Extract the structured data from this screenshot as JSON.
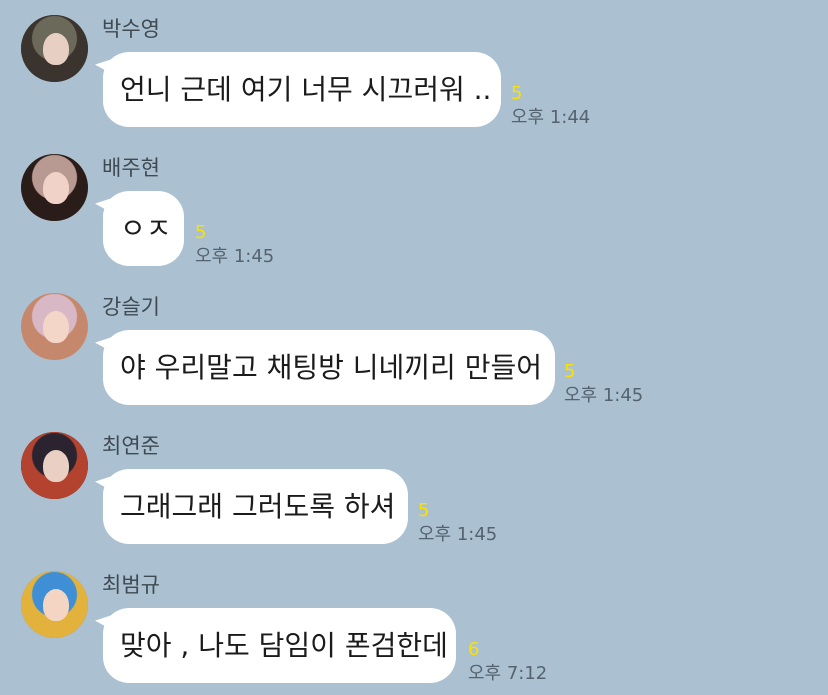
{
  "chat": {
    "messages": [
      {
        "sender": "박수영",
        "text": "언니 근데 여기 너무 시끄러워 ..",
        "unread": "5",
        "time": "오후 1:44",
        "avatar_colors": {
          "hair": "#3b332e",
          "face": "#e8cfc3",
          "bg": "#6b6a5a"
        }
      },
      {
        "sender": "배주현",
        "text": "ㅇㅈ",
        "unread": "5",
        "time": "오후 1:45",
        "avatar_colors": {
          "hair": "#2a1c18",
          "face": "#f1d2c8",
          "bg": "#b89a92"
        }
      },
      {
        "sender": "강슬기",
        "text": "야 우리말고 채팅방 니네끼리 만들어",
        "unread": "5",
        "time": "오후 1:45",
        "avatar_colors": {
          "hair": "#c6886d",
          "face": "#f3d6c7",
          "bg": "#d7b8c4"
        }
      },
      {
        "sender": "최연준",
        "text": "그래그래 그러도록 하셔",
        "unread": "5",
        "time": "오후 1:45",
        "avatar_colors": {
          "hair": "#b3422f",
          "face": "#ead0c2",
          "bg": "#2b2430"
        }
      },
      {
        "sender": "최범규",
        "text": "맞아 , 나도 담임이 폰검한데",
        "unread": "6",
        "time": "오후 7:12",
        "avatar_colors": {
          "hair": "#e3b23d",
          "face": "#f4d5c3",
          "bg": "#3f8fd6"
        }
      }
    ]
  }
}
